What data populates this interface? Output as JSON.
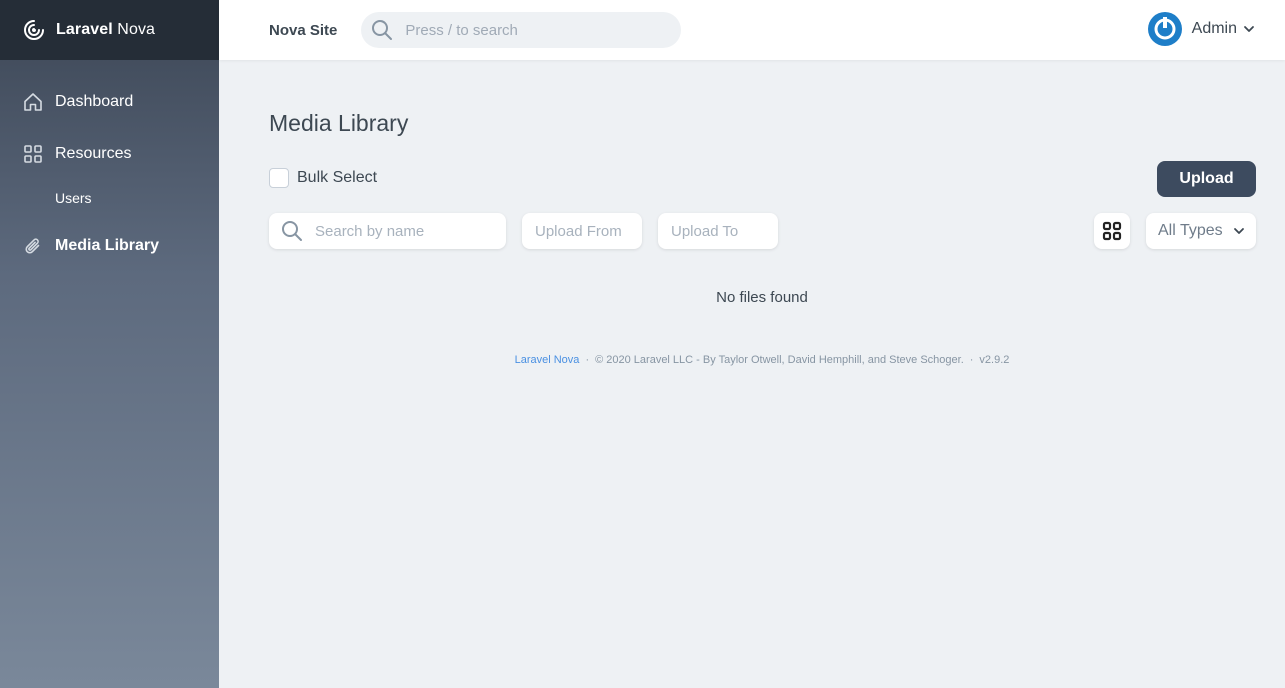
{
  "brand": {
    "name_bold": "Laravel",
    "name_rest": "Nova"
  },
  "sidebar": {
    "items": [
      {
        "label": "Dashboard",
        "icon": "home-icon"
      },
      {
        "label": "Resources",
        "icon": "grid-icon"
      },
      {
        "label": "Users"
      },
      {
        "label": "Media Library",
        "icon": "paperclip-icon"
      }
    ]
  },
  "header": {
    "site_name": "Nova Site",
    "search_placeholder": "Press / to search",
    "user_name": "Admin"
  },
  "main": {
    "title": "Media Library",
    "bulk_select_label": "Bulk Select",
    "upload_label": "Upload",
    "search_placeholder": "Search by name",
    "upload_from_placeholder": "Upload From",
    "upload_to_placeholder": "Upload To",
    "type_filter_value": "All Types",
    "empty_message": "No files found"
  },
  "footer": {
    "link_text": "Laravel Nova",
    "copyright": "© 2020 Laravel LLC - By Taylor Otwell, David Hemphill, and Steve Schoger.",
    "version": "v2.9.2"
  },
  "colors": {
    "sidebar_top": "#252d37",
    "primary_button": "#3d4b5f",
    "link": "#4a90e2",
    "avatar": "#1e7ec8"
  }
}
